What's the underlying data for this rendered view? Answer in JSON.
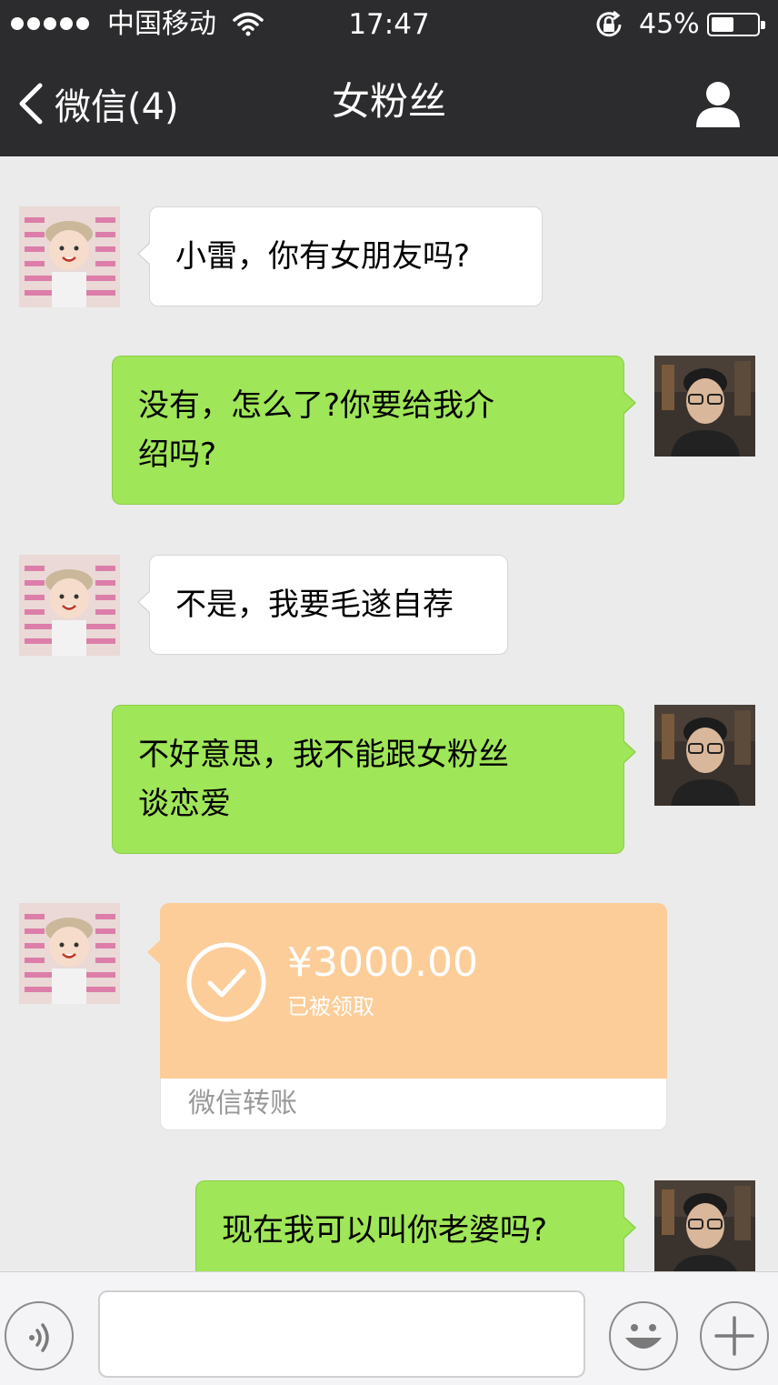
{
  "status_bar": {
    "carrier": "中国移动",
    "time": "17:47",
    "battery_percent_label": "45%",
    "battery_level": 0.45,
    "signal_bars": 5,
    "icons": [
      "signal-dots-icon",
      "wifi-icon",
      "orientation-lock-icon",
      "battery-icon"
    ]
  },
  "nav": {
    "back_label": "微信(4)",
    "title": "女粉丝",
    "profile_icon": "person-icon"
  },
  "messages": [
    {
      "side": "left",
      "sender": "girl",
      "text": "小雷，你有女朋友吗?"
    },
    {
      "side": "right",
      "sender": "me",
      "lines": [
        "没有，怎么了?你要给我介",
        "绍吗?"
      ]
    },
    {
      "side": "left",
      "sender": "girl",
      "text": "不是，我要毛遂自荐"
    },
    {
      "side": "right",
      "sender": "me",
      "lines": [
        "不好意思，我不能跟女粉丝",
        "谈恋爱"
      ]
    },
    {
      "side": "left",
      "sender": "girl",
      "type": "transfer",
      "amount": "¥3000.00",
      "status": "已被领取",
      "label": "微信转账"
    },
    {
      "side": "right",
      "sender": "me",
      "text": "现在我可以叫你老婆吗?"
    }
  ],
  "input_bar": {
    "value": "",
    "icons": [
      "voice-icon",
      "emoji-icon",
      "plus-icon"
    ]
  },
  "colors": {
    "header_bg": "#2c2c2e",
    "chat_bg": "#ebebeb",
    "outgoing_bubble": "#9fe658",
    "incoming_bubble": "#ffffff",
    "transfer_card": "#fccd99"
  }
}
